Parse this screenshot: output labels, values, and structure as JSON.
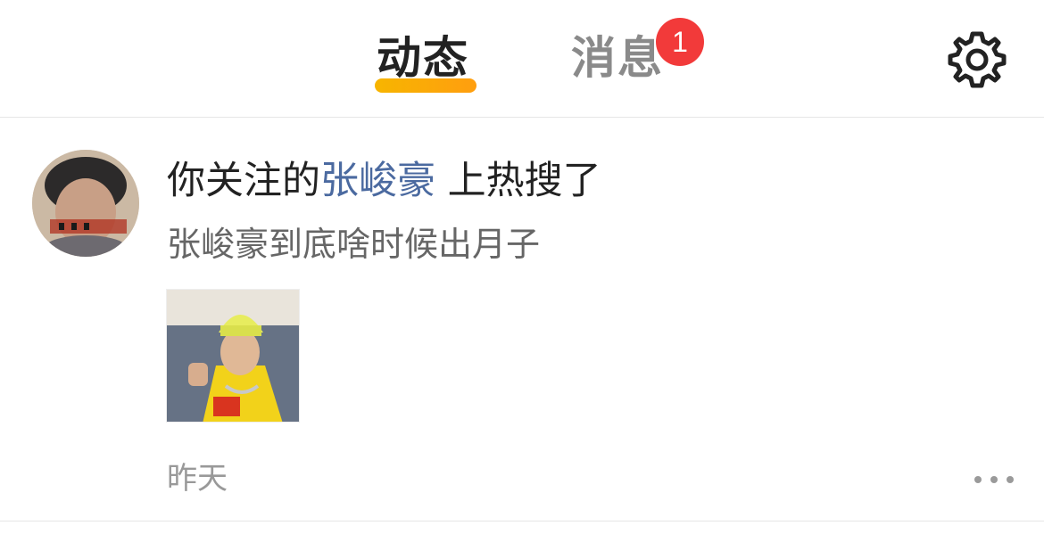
{
  "tabs": {
    "active": "动态",
    "inactive": "消息",
    "badge_count": "1"
  },
  "header": {
    "settings_icon": "gear-icon"
  },
  "notification": {
    "headline_prefix": "你关注的",
    "headline_name": "张峻豪",
    "headline_suffix": " 上热搜了",
    "subtitle": "张峻豪到底啥时候出月子",
    "time": "昨天",
    "more_icon": "ellipsis-icon"
  },
  "colors": {
    "accent": "#f7b500",
    "badge": "#f23a3a",
    "link": "#4b6aa0"
  }
}
